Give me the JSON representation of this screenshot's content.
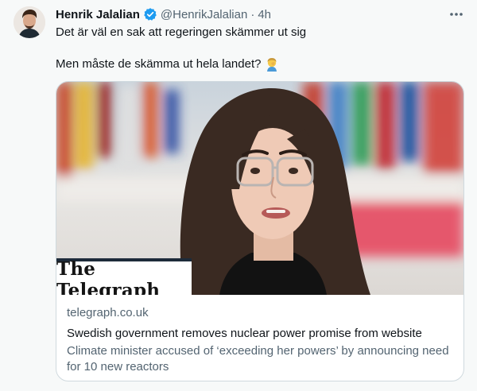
{
  "tweet": {
    "author_name": "Henrik Jalalian",
    "author_handle": "@HenrikJalalian",
    "separator": "·",
    "timestamp": "4h",
    "text_line1": "Det är väl en sak att regeringen skämmer ut sig",
    "text_line2": "Men måste de skämma ut hela landet?",
    "emoji": "facepalm-emoji"
  },
  "link_card": {
    "brand": "The Telegraph",
    "domain": "telegraph.co.uk",
    "title": "Swedish government removes nuclear power promise from website",
    "description": "Climate minister accused of ‘exceeding her powers’ by announcing need for 10 new reactors"
  },
  "colors": {
    "background": "#f7f9f9",
    "text_primary": "#0f1419",
    "text_secondary": "#536471",
    "verified": "#1d9bf0",
    "card_border": "#cfd9de"
  },
  "icons": [
    "avatar",
    "verified-badge-icon",
    "more-options-icon",
    "facepalm-emoji"
  ]
}
